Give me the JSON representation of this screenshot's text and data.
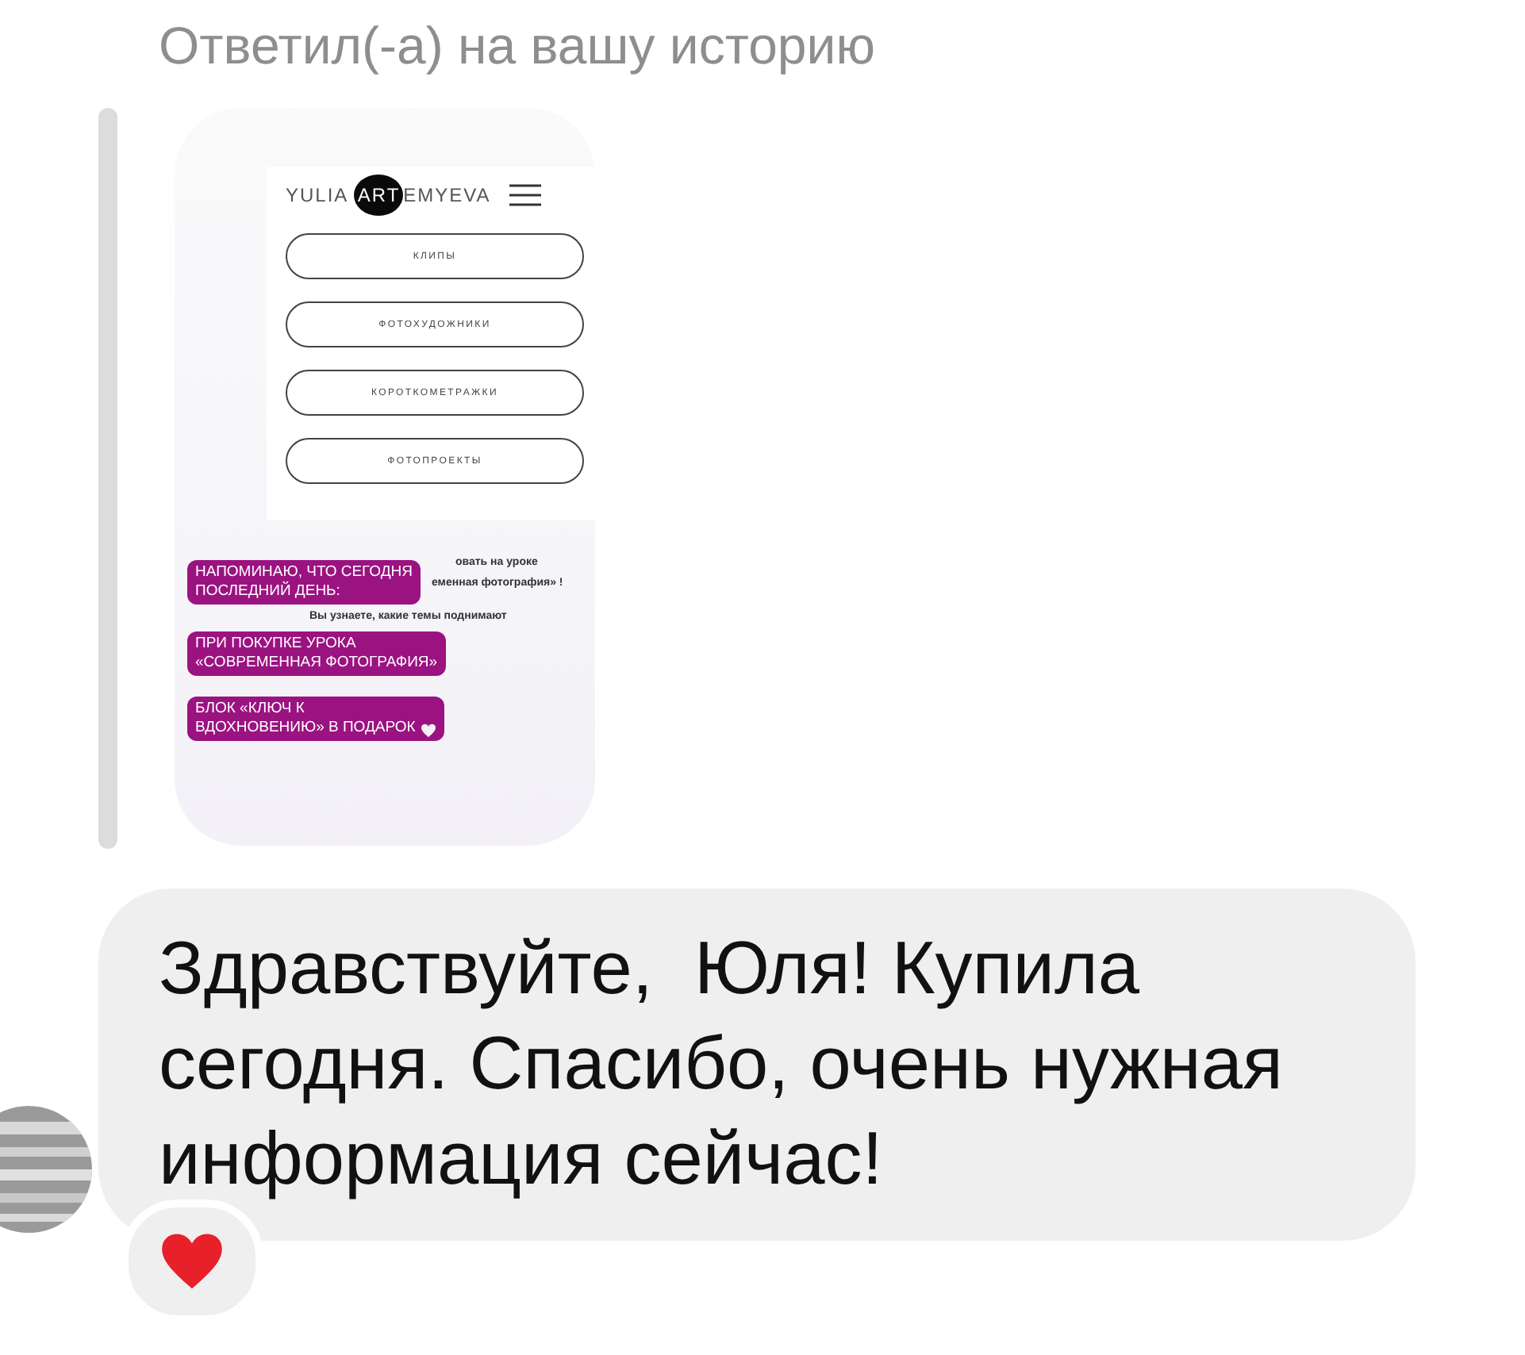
{
  "reply_label": "Ответил(-а) на вашу историю",
  "story": {
    "logo": {
      "before": "YULIA ",
      "mark": "ART",
      "after": "EMYEVA"
    },
    "menu_buttons": [
      "КЛИПЫ",
      "ФОТОХУДОЖНИКИ",
      "КОРОТКОМЕТРАЖКИ",
      "ФОТОПРОЕКТЫ"
    ],
    "background_text": [
      "овать на уроке",
      "еменная фотография» !",
      "Вы узнаете, какие темы поднимают"
    ],
    "stickers": [
      {
        "text": "НАПОМИНАЮ, ЧТО СЕГОДНЯ\nПОСЛЕДНИЙ ДЕНЬ:",
        "heart": false
      },
      {
        "text": "ПРИ ПОКУПКЕ УРОКА\n«СОВРЕМЕННАЯ ФОТОГРАФИЯ»",
        "heart": false
      },
      {
        "text": "БЛОК «КЛЮЧ К\nВДОХНОВЕНИЮ» В ПОДАРОК",
        "heart": true
      }
    ]
  },
  "message": {
    "text": "Здравствуйте,  Юля! Купила сегодня. Спасибо, очень нужная информация сейчас!"
  },
  "reaction": {
    "kind": "heart"
  }
}
